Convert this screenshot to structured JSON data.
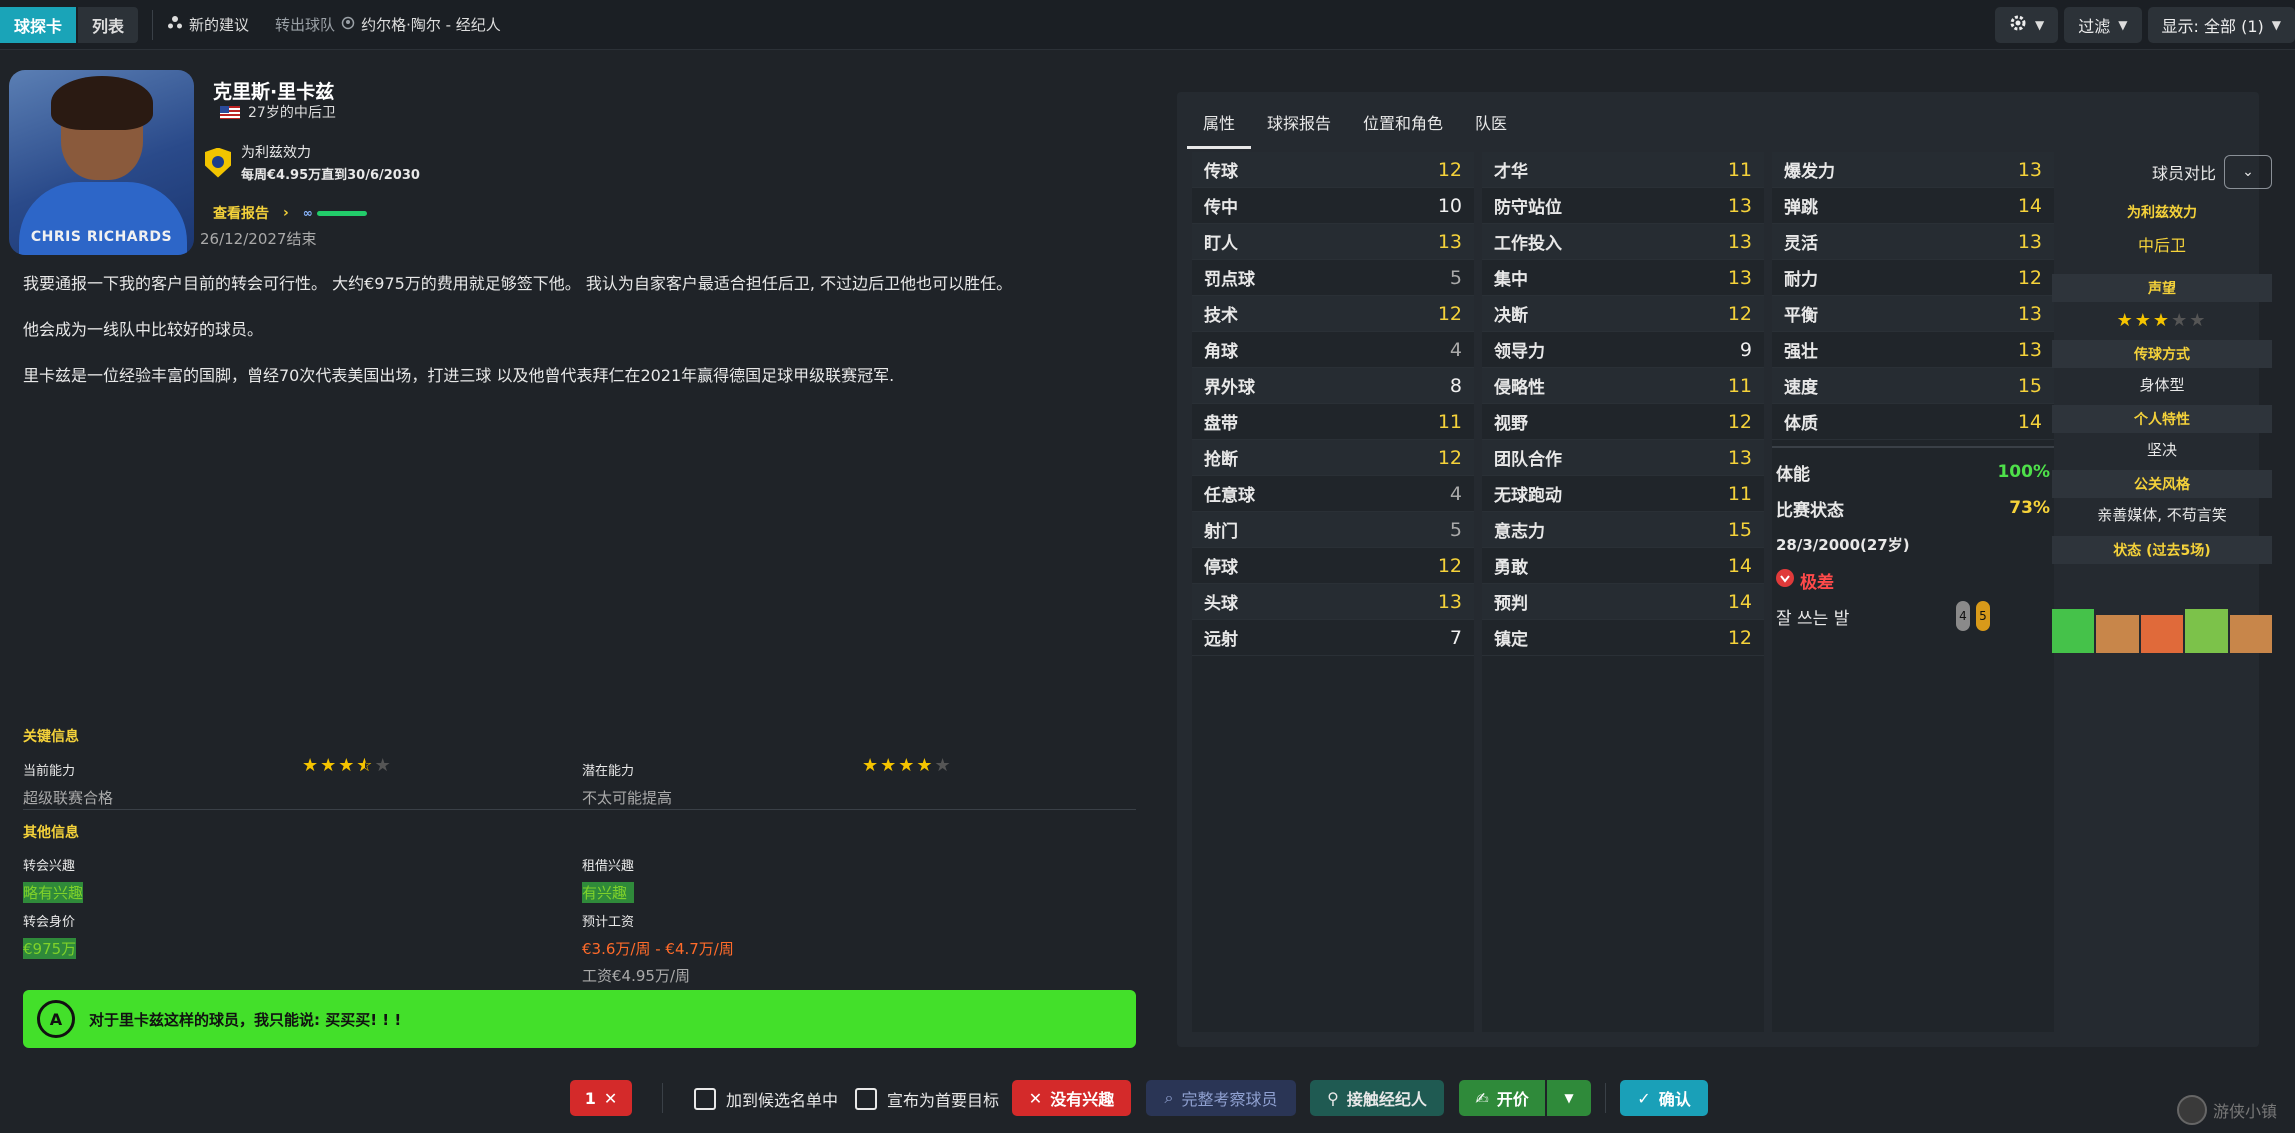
{
  "topbar": {
    "tab_scout": "球探卡",
    "tab_list": "列表",
    "new_suggestion": "新的建议",
    "transfer_club": "转出球队",
    "agent": "约尔格·陶尔 - 经纪人",
    "filter": "过滤",
    "display": "显示: 全部 (1)"
  },
  "player": {
    "photo_name": "CHRIS RICHARDS",
    "name": "克里斯·里卡兹",
    "age_position": "27岁的中后卫",
    "club_line": "为利兹效力",
    "wage_line": "每周€4.95万直到30/6/2030",
    "report_link": "查看报告",
    "report_end": "26/12/2027结束"
  },
  "quote": [
    "我要通报一下我的客户目前的转会可行性。 大约€975万的费用就足够签下他。 我认为自家客户最适合担任后卫, 不过边后卫他也可以胜任。",
    "他会成为一线队中比较好的球员。",
    "里卡兹是一位经验丰富的国脚，曾经70次代表美国出场，打进三球 以及他曾代表拜仁在2021年赢得德国足球甲级联赛冠军."
  ],
  "key_info": {
    "title": "关键信息",
    "current_ability_label": "当前能力",
    "current_ability_value": "超级联赛合格",
    "current_ability_stars": 3.5,
    "potential_ability_label": "潜在能力",
    "potential_ability_value": "不太可能提高",
    "potential_ability_stars": 4
  },
  "other_info": {
    "title": "其他信息",
    "transfer_interest_label": "转会兴趣",
    "transfer_interest_value": "略有兴趣",
    "loan_interest_label": "租借兴趣",
    "loan_interest_value": "有兴趣",
    "transfer_value_label": "转会身价",
    "transfer_value_value": "€975万",
    "expected_wage_label": "预计工资",
    "expected_wage_value": "€3.6万/周 - €4.7万/周",
    "current_wage": "工资€4.95万/周"
  },
  "banner": {
    "grade": "A",
    "text": "对于里卡兹这样的球员，我只能说: 买买买! ! !"
  },
  "right_tabs": [
    "属性",
    "球探报告",
    "位置和角色",
    "队医"
  ],
  "attributes": {
    "technical": [
      {
        "name": "传球",
        "value": "12",
        "tone": "y"
      },
      {
        "name": "传中",
        "value": "10",
        "tone": "w"
      },
      {
        "name": "盯人",
        "value": "13",
        "tone": "y"
      },
      {
        "name": "罚点球",
        "value": "5",
        "tone": "g"
      },
      {
        "name": "技术",
        "value": "12",
        "tone": "y"
      },
      {
        "name": "角球",
        "value": "4",
        "tone": "g"
      },
      {
        "name": "界外球",
        "value": "8",
        "tone": "w"
      },
      {
        "name": "盘带",
        "value": "11",
        "tone": "y"
      },
      {
        "name": "抢断",
        "value": "12",
        "tone": "y"
      },
      {
        "name": "任意球",
        "value": "4",
        "tone": "g"
      },
      {
        "name": "射门",
        "value": "5",
        "tone": "g"
      },
      {
        "name": "停球",
        "value": "12",
        "tone": "y"
      },
      {
        "name": "头球",
        "value": "13",
        "tone": "y"
      },
      {
        "name": "远射",
        "value": "7",
        "tone": "w"
      }
    ],
    "mental": [
      {
        "name": "才华",
        "value": "11",
        "tone": "y"
      },
      {
        "name": "防守站位",
        "value": "13",
        "tone": "y"
      },
      {
        "name": "工作投入",
        "value": "13",
        "tone": "y"
      },
      {
        "name": "集中",
        "value": "13",
        "tone": "y"
      },
      {
        "name": "决断",
        "value": "12",
        "tone": "y"
      },
      {
        "name": "领导力",
        "value": "9",
        "tone": "w"
      },
      {
        "name": "侵略性",
        "value": "11",
        "tone": "y"
      },
      {
        "name": "视野",
        "value": "12",
        "tone": "y"
      },
      {
        "name": "团队合作",
        "value": "13",
        "tone": "y"
      },
      {
        "name": "无球跑动",
        "value": "11",
        "tone": "y"
      },
      {
        "name": "意志力",
        "value": "15",
        "tone": "y"
      },
      {
        "name": "勇敢",
        "value": "14",
        "tone": "y"
      },
      {
        "name": "预判",
        "value": "14",
        "tone": "y"
      },
      {
        "name": "镇定",
        "value": "12",
        "tone": "y"
      }
    ],
    "physical": [
      {
        "name": "爆发力",
        "value": "13",
        "tone": "y"
      },
      {
        "name": "弹跳",
        "value": "14",
        "tone": "y"
      },
      {
        "name": "灵活",
        "value": "13",
        "tone": "y"
      },
      {
        "name": "耐力",
        "value": "12",
        "tone": "y"
      },
      {
        "name": "平衡",
        "value": "13",
        "tone": "y"
      },
      {
        "name": "强壮",
        "value": "13",
        "tone": "y"
      },
      {
        "name": "速度",
        "value": "15",
        "tone": "y"
      },
      {
        "name": "体质",
        "value": "14",
        "tone": "y"
      }
    ]
  },
  "condition": {
    "fitness_label": "体能",
    "fitness_value": "100%",
    "match_label": "比赛状态",
    "match_value": "73%",
    "dob": "28/3/2000(27岁)",
    "status": "极差",
    "foot_label": "잘 쓰는 발",
    "left_foot": "4",
    "right_foot": "5"
  },
  "comparison": {
    "title": "球员对比",
    "club": "为利兹效力",
    "position": "中后卫",
    "reputation_label": "声望",
    "reputation_stars": 3,
    "style_label": "传球方式",
    "style_value": "身体型",
    "trait_label": "个人特性",
    "trait_value": "坚决",
    "media_label": "公关风格",
    "media_value": "亲善媒体, 不苟言笑",
    "form_label": "状态 (过去5场)",
    "form_colors": [
      "#45c24a",
      "#c8864a",
      "#e06a3a",
      "#7cc24a",
      "#c8864a"
    ]
  },
  "bottom": {
    "counter": "1",
    "shortlist": "加到候选名单中",
    "priority": "宣布为首要目标",
    "not_interested": "没有兴趣",
    "full_scout": "完整考察球员",
    "contact_agent": "接触经纪人",
    "bid": "开价",
    "confirm": "确认"
  },
  "watermark": "游侠小镇"
}
